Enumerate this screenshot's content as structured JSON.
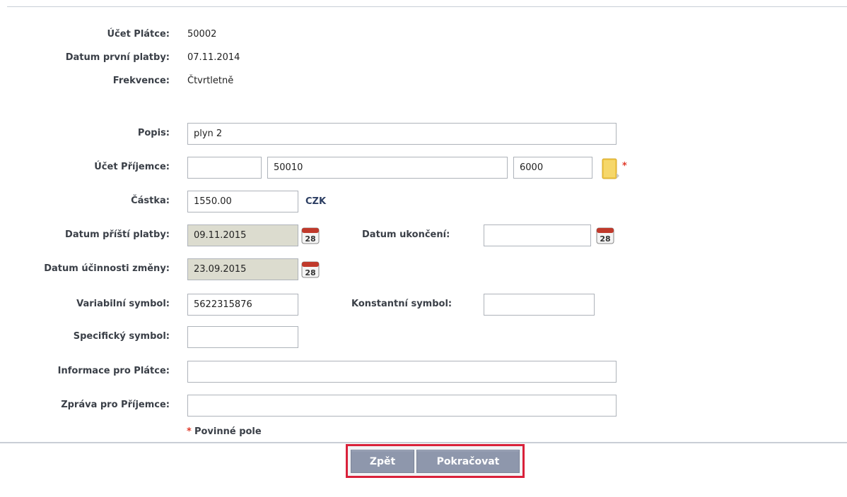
{
  "info": {
    "payer_account_label": "Účet Plátce:",
    "payer_account_value": "50002",
    "first_payment_label": "Datum první platby:",
    "first_payment_value": "07.11.2014",
    "frequency_label": "Frekvence:",
    "frequency_value": "Čtvrtletně"
  },
  "form": {
    "description_label": "Popis:",
    "description_value": "plyn 2",
    "recipient_account_label": "Účet Příjemce:",
    "recipient_prefix_value": "",
    "recipient_number_value": "50010",
    "recipient_bank_code_value": "6000",
    "amount_label": "Částka:",
    "amount_value": "1550.00",
    "currency": "CZK",
    "next_payment_label": "Datum příští platby:",
    "next_payment_value": "09.11.2015",
    "end_date_label": "Datum ukončení:",
    "end_date_value": "",
    "change_effective_label": "Datum účinnosti změny:",
    "change_effective_value": "23.09.2015",
    "variable_symbol_label": "Variabilní symbol:",
    "variable_symbol_value": "5622315876",
    "constant_symbol_label": "Konstantní symbol:",
    "constant_symbol_value": "",
    "specific_symbol_label": "Specifický symbol:",
    "specific_symbol_value": "",
    "payer_info_label": "Informace pro Plátce:",
    "payer_info_value": "",
    "recipient_message_label": "Zpráva pro Příjemce:",
    "recipient_message_value": "",
    "required_star": "*",
    "required_note": "Povinné pole",
    "calendar_day": "28"
  },
  "buttons": {
    "back_label": "Zpět",
    "continue_label": "Pokračovat"
  },
  "icons": {
    "calendar": "calendar-icon",
    "folder": "folder-icon"
  },
  "colors": {
    "button_bg": "#8e97ac",
    "highlight_frame": "#d9213a",
    "readonly_bg": "#dcdccf",
    "required_star": "#e03a2a"
  }
}
